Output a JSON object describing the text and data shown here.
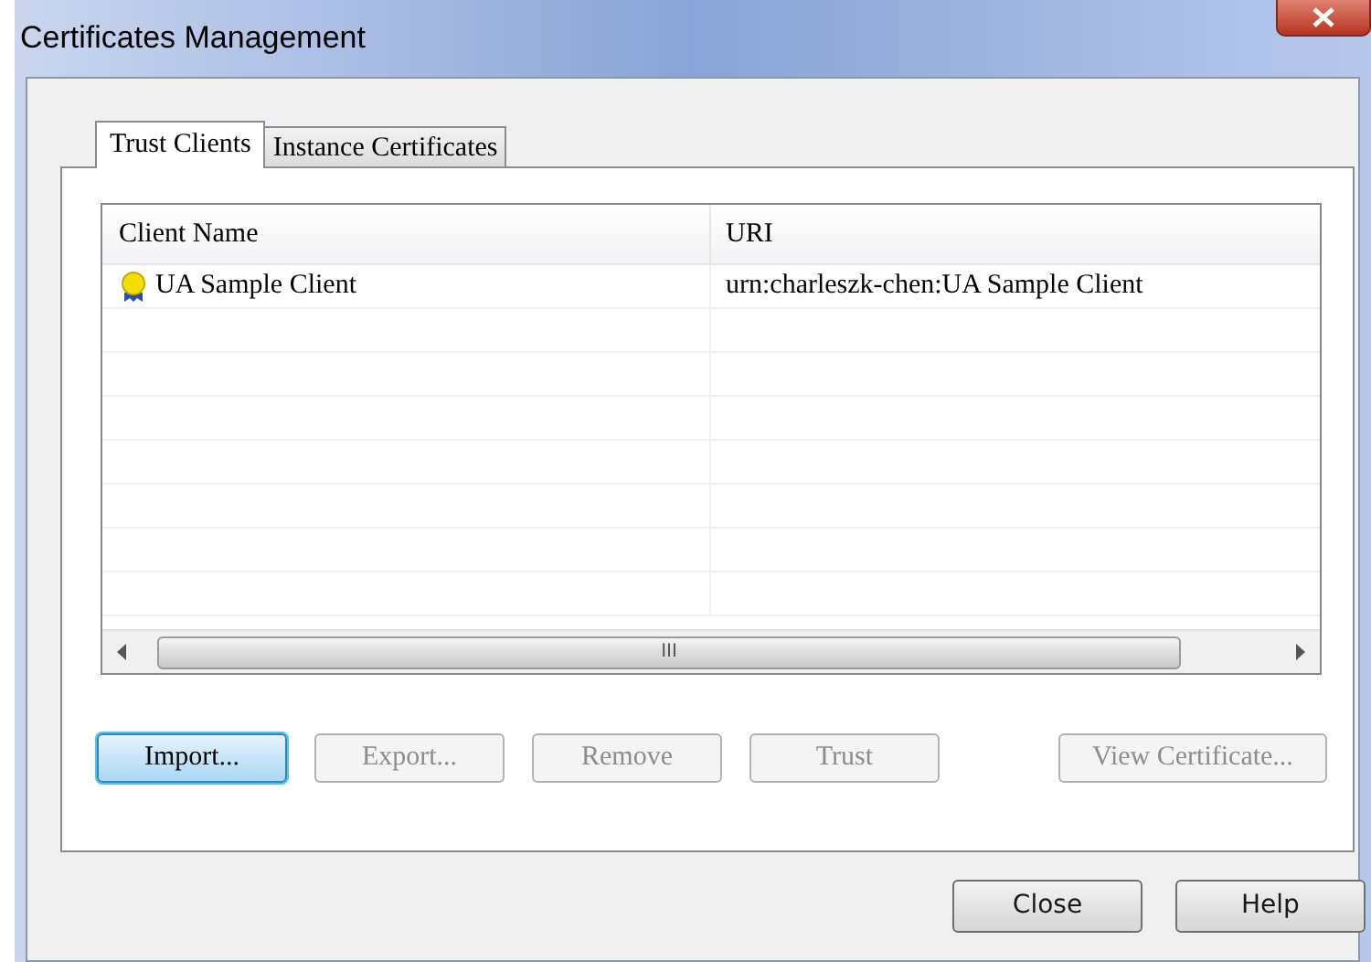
{
  "window": {
    "title": "Certificates Management"
  },
  "tabs": [
    {
      "label": "Trust Clients",
      "selected": true
    },
    {
      "label": "Instance Certificates",
      "selected": false
    }
  ],
  "table": {
    "columns": [
      "Client Name",
      "URI"
    ],
    "rows": [
      {
        "name": "UA Sample Client",
        "uri": "urn:charleszk-chen:UA Sample Client"
      }
    ]
  },
  "scrollbar_grip": "III",
  "actions": [
    {
      "label": "Import...",
      "disabled": false,
      "default": true
    },
    {
      "label": "Export...",
      "disabled": true,
      "default": false
    },
    {
      "label": "Remove",
      "disabled": true,
      "default": false
    },
    {
      "label": "Trust",
      "disabled": true,
      "default": false
    },
    {
      "label": "View Certificate...",
      "disabled": true,
      "default": false
    }
  ],
  "dialog_buttons": [
    "Close",
    "Help"
  ]
}
